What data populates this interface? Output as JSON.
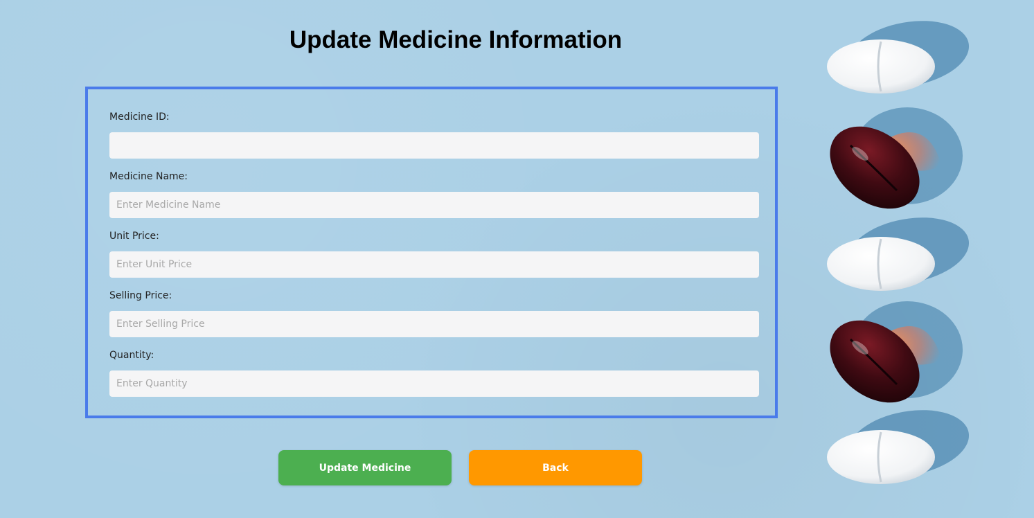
{
  "page": {
    "title": "Update Medicine Information"
  },
  "form": {
    "fields": [
      {
        "label": "Medicine ID:",
        "value": "",
        "placeholder": ""
      },
      {
        "label": "Medicine Name:",
        "value": "",
        "placeholder": "Enter Medicine Name"
      },
      {
        "label": "Unit Price:",
        "value": "",
        "placeholder": "Enter Unit Price"
      },
      {
        "label": "Selling Price:",
        "value": "",
        "placeholder": "Enter Selling Price"
      },
      {
        "label": "Quantity:",
        "value": "",
        "placeholder": "Enter Quantity"
      }
    ]
  },
  "actions": {
    "update_label": "Update Medicine",
    "back_label": "Back"
  },
  "colors": {
    "background": "#abd0e6",
    "panel_border": "#4a7bea",
    "update_button": "#4caf50",
    "back_button": "#ff9800",
    "input_background": "#f5f5f6"
  },
  "decoration": {
    "image": "pills-and-capsules-photo"
  }
}
